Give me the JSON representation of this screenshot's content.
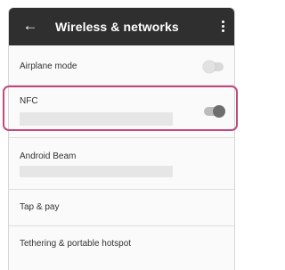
{
  "app_bar": {
    "title": "Wireless & networks",
    "back_icon": "arrow-left-icon",
    "menu_icon": "more-vert-icon"
  },
  "settings": {
    "airplane_mode": {
      "label": "Airplane mode",
      "toggle": "off"
    },
    "nfc": {
      "label": "NFC",
      "toggle": "on"
    },
    "android_beam": {
      "label": "Android Beam"
    },
    "tap_pay": {
      "label": "Tap & pay"
    },
    "tethering": {
      "label": "Tethering & portable hotspot"
    }
  },
  "colors": {
    "app_bar_bg": "#2f2f2f",
    "highlight": "#c2497e"
  }
}
